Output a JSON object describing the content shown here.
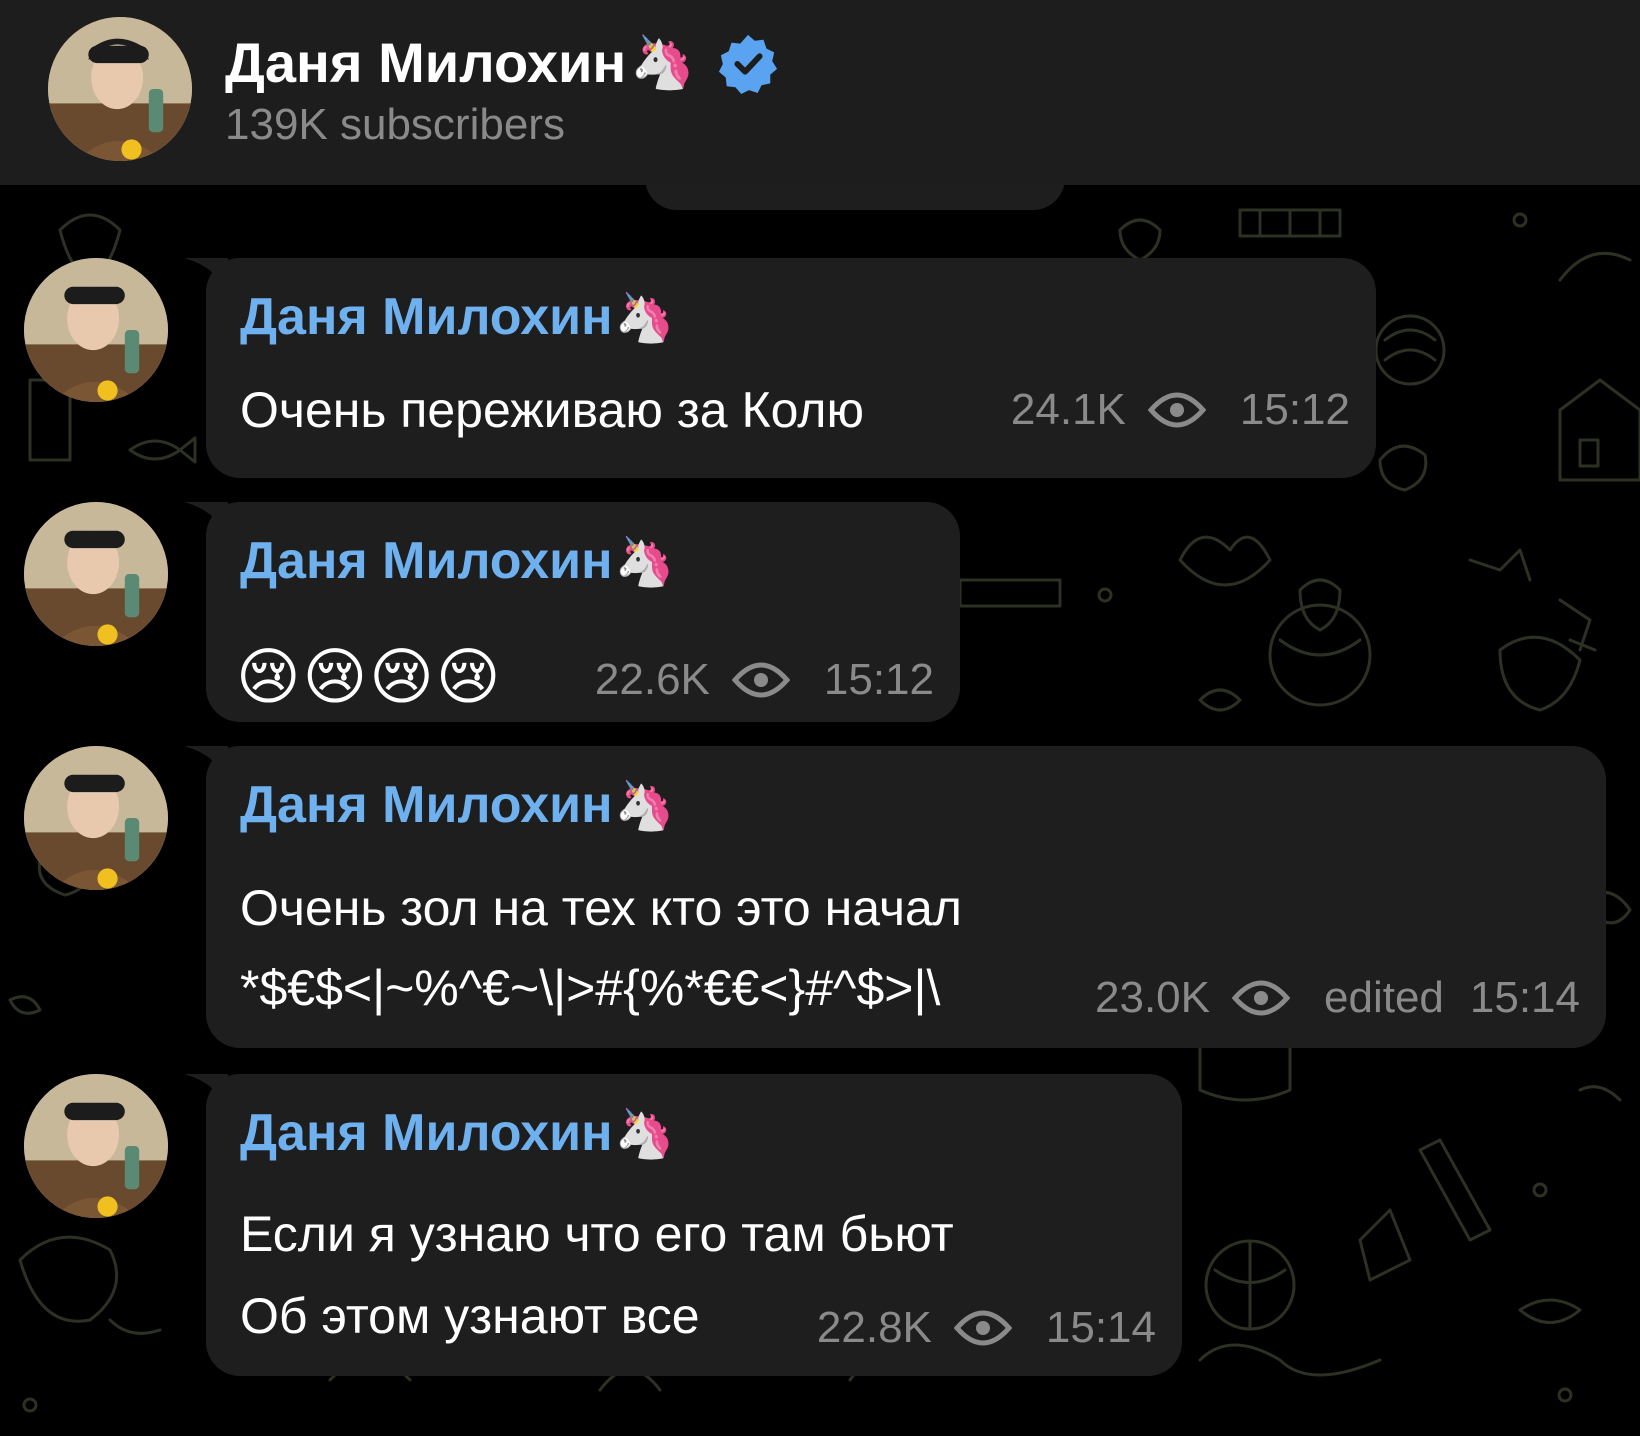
{
  "channel": {
    "name": "Даня Милохин",
    "name_emoji": "🦄",
    "subscribers": "139K subscribers"
  },
  "messages": [
    {
      "sender": "Даня Милохин",
      "sender_emoji": "🦄",
      "text": "Очень переживаю за Колю",
      "views": "24.1K",
      "time": "15:12"
    },
    {
      "sender": "Даня Милохин",
      "sender_emoji": "🦄",
      "emojis": "😢😢😢😢",
      "views": "22.6K",
      "time": "15:12"
    },
    {
      "sender": "Даня Милохин",
      "sender_emoji": "🦄",
      "line1": "Очень зол на тех кто это начал",
      "line2": "*$€$<|~%^€~\\|>#{%*€€<}#^$>|\\",
      "views": "23.0K",
      "edited": "edited",
      "time": "15:14"
    },
    {
      "sender": "Даня Милохин",
      "sender_emoji": "🦄",
      "line1": "Если я узнаю что его там бьют",
      "line2": "Об этом узнают все",
      "views": "22.8K",
      "time": "15:14"
    }
  ],
  "colors": {
    "background": "#000000",
    "header": "#1d1d1d",
    "bubble": "#1e1e1e",
    "sender_name": "#6fb0ee",
    "meta_text": "#8a8a8a",
    "verified_badge": "#5aa3f0",
    "doodle_stroke": "#2a2f22"
  },
  "icons": {
    "verified": "verified-badge-icon",
    "views": "eye-icon",
    "avatar": "channel-avatar"
  }
}
